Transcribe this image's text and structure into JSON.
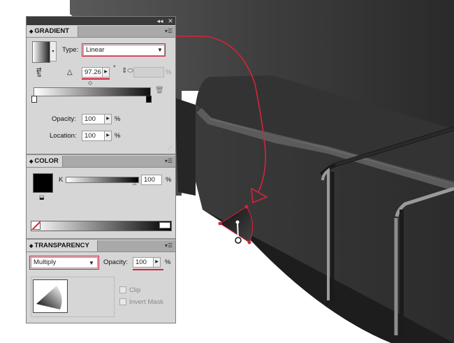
{
  "window": {
    "collapse_glyph": "◂◂",
    "close_glyph": "✕"
  },
  "gradient": {
    "tab_label": "GRADIENT",
    "type_label": "Type:",
    "type_value": "Linear",
    "angle_value": "97.26",
    "angle_unit": "°",
    "aspect_unit": "%",
    "opacity_label": "Opacity:",
    "opacity_value": "100",
    "location_label": "Location:",
    "location_value": "100",
    "percent": "%"
  },
  "color": {
    "tab_label": "COLOR",
    "channel_label": "K",
    "channel_value": "100",
    "percent": "%",
    "fill_color": "#000000"
  },
  "transparency": {
    "tab_label": "TRANSPARENCY",
    "blend_mode": "Multiply",
    "opacity_label": "Opacity:",
    "opacity_value": "100",
    "percent": "%",
    "clip_label": "Clip",
    "invert_mask_label": "Invert Mask"
  },
  "colors": {
    "highlight": "#d9223a",
    "panel_bg": "#d6d6d6",
    "tab_bar": "#a9a9a9"
  }
}
